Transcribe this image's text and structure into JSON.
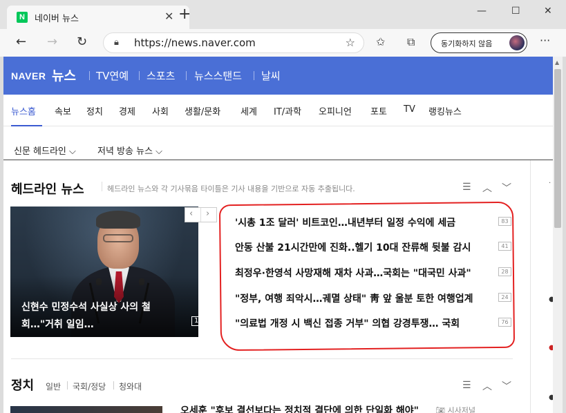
{
  "browser": {
    "tab_title": "네이버 뉴스",
    "favicon_letter": "N",
    "url": "https://news.naver.com",
    "sync_label": "동기화하지 않음",
    "win_controls": [
      "—",
      "☐",
      "✕"
    ]
  },
  "header": {
    "brand": "NAVER",
    "service": "뉴스",
    "nav": [
      "TV연예",
      "스포츠",
      "뉴스스탠드",
      "날씨"
    ]
  },
  "sections": [
    "뉴스홈",
    "속보",
    "정치",
    "경제",
    "사회",
    "생활/문화",
    "세계",
    "IT/과학",
    "오피니언",
    "포토",
    "TV",
    "랭킹뉴스"
  ],
  "subnav": [
    "신문 헤드라인 ⌵",
    "저녁 방송 뉴스 ⌵"
  ],
  "headline": {
    "title": "헤드라인 뉴스",
    "description": "헤드라인 뉴스와 각 기사묶음 타이틀은 기사 내용을 기반으로 자동 추출됩니다.",
    "photo_caption": "신현수 민정수석 사실상 사의 철회…\"거취 일임…",
    "photo_count": "104",
    "pager_prev": "‹",
    "pager_next": "›",
    "items": [
      {
        "text": "'시총 1조 달러' 비트코인…내년부터 일정 수익에 세금",
        "count": "83"
      },
      {
        "text": "안동 산불 21시간만에 진화..헬기 10대 잔류해 뒷불 감시",
        "count": "41"
      },
      {
        "text": "최정우·한영석 사망재해 재차 사과…국회는 \"대국민 사과\"",
        "count": "28"
      },
      {
        "text": "\"정부, 여행 죄악시…궤멸 상태\" 靑 앞 울분 토한 여행업계",
        "count": "24"
      },
      {
        "text": "\"의료법 개정 시 백신 접종 거부\" 의협 강경투쟁… 국회",
        "count": "76"
      }
    ]
  },
  "politics": {
    "title": "정치",
    "subs": [
      "일반",
      "국회/정당",
      "청와대"
    ],
    "headline": "오세훈 \"후보 결선보다는 정치적 결단에 의한 단일화 해야\"",
    "source": "시사저널"
  },
  "colors": {
    "naver_blue": "#4a6fd6",
    "naver_green": "#03c75a",
    "active_link": "#3b5bd1",
    "annotation_red": "#e32020"
  }
}
